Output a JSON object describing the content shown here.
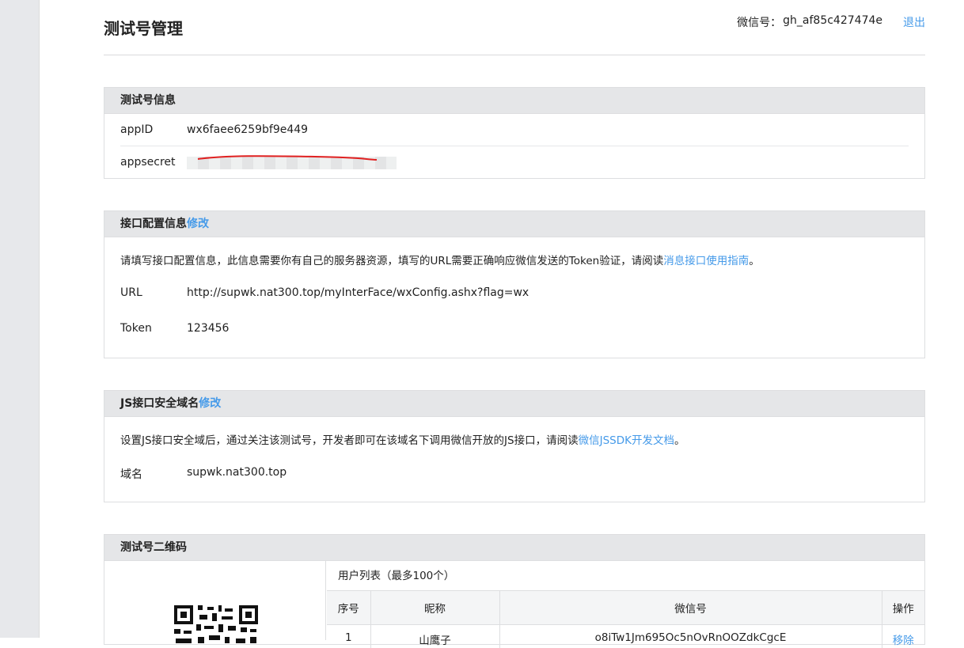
{
  "header": {
    "title": "测试号管理",
    "account_label": "微信号：",
    "account_id": "gh_af85c427474e",
    "logout": "退出"
  },
  "test_info": {
    "title": "测试号信息",
    "appid_label": "appID",
    "appid_value": "wx6faee6259bf9e449",
    "appsecret_label": "appsecret"
  },
  "interface_config": {
    "title": "接口配置信息",
    "edit": "修改",
    "desc_text": "请填写接口配置信息，此信息需要你有自己的服务器资源，填写的URL需要正确响应微信发送的Token验证，请阅读",
    "desc_link": "消息接口使用指南",
    "desc_end": "。",
    "url_label": "URL",
    "url_value": "http://supwk.nat300.top/myInterFace/wxConfig.ashx?flag=wx",
    "token_label": "Token",
    "token_value": "123456"
  },
  "js_domain": {
    "title": "JS接口安全域名",
    "edit": "修改",
    "desc_text": "设置JS接口安全域后，通过关注该测试号，开发者即可在该域名下调用微信开放的JS接口，请阅读",
    "desc_link": "微信JSSDK开发文档",
    "desc_end": "。",
    "domain_label": "域名",
    "domain_value": "supwk.nat300.top"
  },
  "qr_section": {
    "title": "测试号二维码",
    "user_list_caption": "用户列表（最多100个）",
    "columns": [
      "序号",
      "昵称",
      "微信号",
      "操作"
    ],
    "rows": [
      {
        "index": "1",
        "nickname": "山鹰子",
        "wechat_id": "o8iTw1Jm695Oc5nOvRnOOZdkCgcE",
        "action": "移除"
      }
    ]
  },
  "colors": {
    "link": "#459ae9",
    "panel_head": "#e5e6e8"
  }
}
